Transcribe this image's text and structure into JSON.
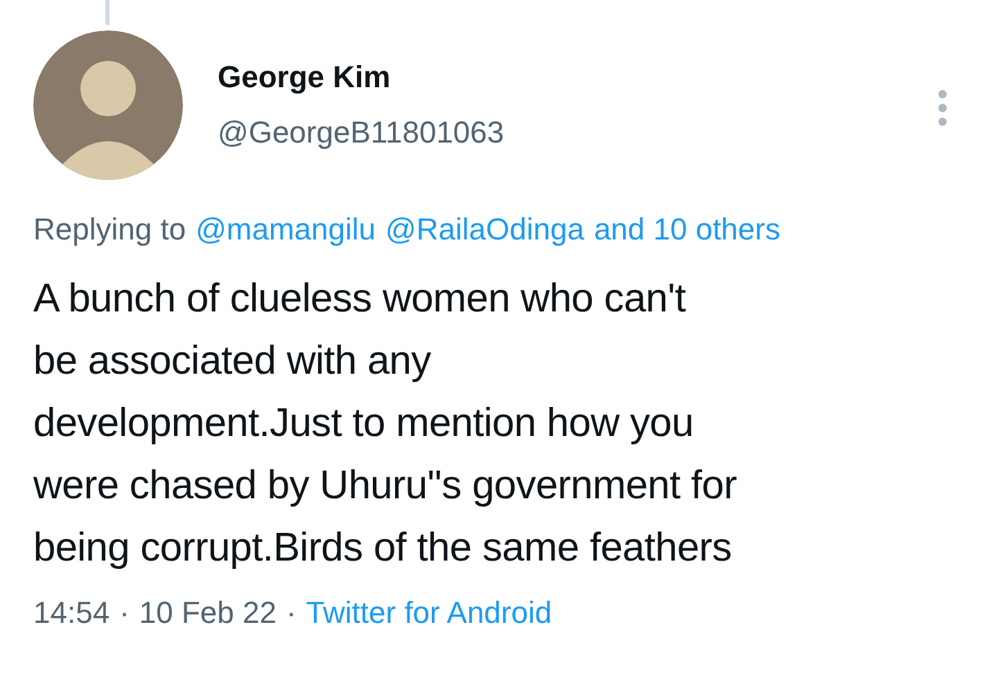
{
  "author": {
    "name": "George Kim",
    "handle": "@GeorgeB11801063"
  },
  "replying_to": {
    "label": "Replying to",
    "mentions": [
      "@mamangilu",
      "@RailaOdinga"
    ],
    "others": "and 10 others"
  },
  "body": {
    "lines": [
      "A bunch of clueless women who can't",
      "be associated with any",
      "development.Just to mention how you",
      "were chased by Uhuru''s government for",
      "being corrupt.Birds of the same feathers"
    ]
  },
  "footer": {
    "time": "14:54",
    "separator": "·",
    "date": "10 Feb 22",
    "source": "Twitter for Android"
  }
}
